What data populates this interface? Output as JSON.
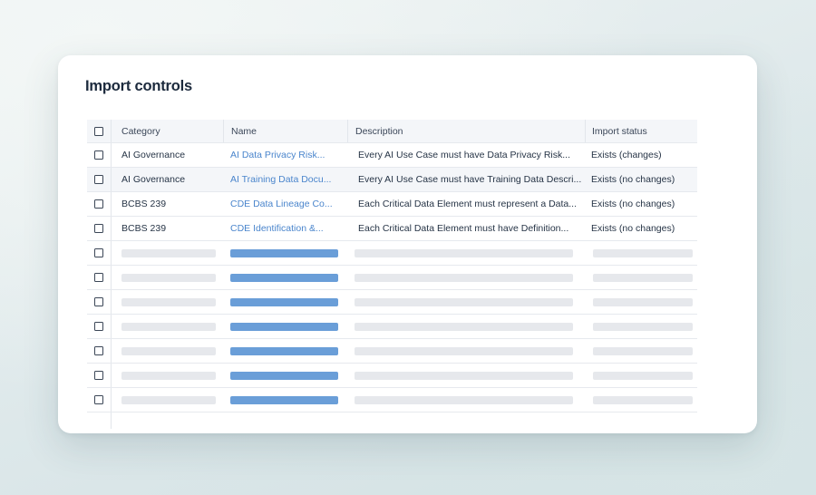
{
  "dialog": {
    "title": "Import controls"
  },
  "table": {
    "columns": {
      "category": "Category",
      "name": "Name",
      "description": "Description",
      "status": "Import status"
    },
    "rows": [
      {
        "category": "AI Governance",
        "name": "AI Data Privacy Risk...",
        "description": "Every AI Use Case must have Data Privacy Risk...",
        "status": "Exists (changes)"
      },
      {
        "category": "AI Governance",
        "name": "AI Training Data Docu...",
        "description": "Every AI Use Case must have Training Data Descri...",
        "status": "Exists (no changes)"
      },
      {
        "category": "BCBS 239",
        "name": "CDE Data Lineage Co...",
        "description": "Each Critical Data Element must represent a Data...",
        "status": "Exists (no changes)"
      },
      {
        "category": "BCBS 239",
        "name": "CDE Identification &...",
        "description": "Each Critical Data Element must have Definition...",
        "status": "Exists (no changes)"
      }
    ],
    "placeholder_row_count": 7
  },
  "colors": {
    "link": "#4a85cc",
    "skeleton_name": "#6a9ed8",
    "skeleton_gray": "#e6e8ec",
    "title": "#1c2a3d"
  },
  "icons": {
    "checkbox": "checkbox-icon"
  }
}
